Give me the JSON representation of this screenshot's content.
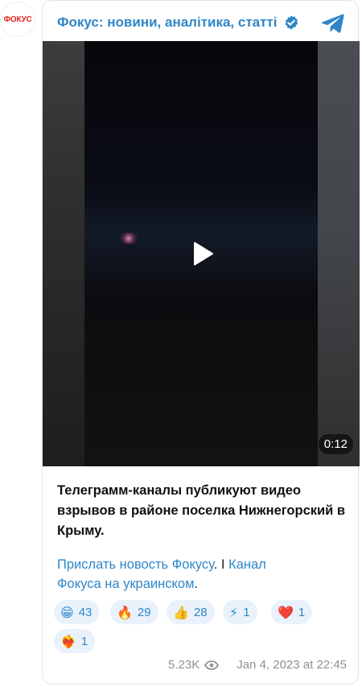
{
  "avatar": {
    "label": "ФОКУС"
  },
  "channel": {
    "title": "Фокус: новини, аналітика, статті"
  },
  "video": {
    "duration": "0:12"
  },
  "message": {
    "text": "Телеграмм-каналы публикуют видео взрывов в районе поселка Нижнегорский в Крыму.",
    "link1": "Прислать новость ",
    "link1_italic": "Фокусу",
    "sep": ". I ",
    "link2": "Канал",
    "link2_italic": "Фокуса",
    "link2_rest": " на украинском",
    "end": "."
  },
  "reactions": [
    {
      "emoji": "😁",
      "count": "43"
    },
    {
      "emoji": "🔥",
      "count": "29"
    },
    {
      "emoji": "👍",
      "count": "28"
    },
    {
      "emoji": "⚡",
      "count": "1"
    },
    {
      "emoji": "❤️",
      "count": "1"
    },
    {
      "emoji": "❤️‍🔥",
      "count": "1"
    }
  ],
  "footer": {
    "views": "5.23K",
    "date": "Jan 4, 2023 at 22:45"
  },
  "colors": {
    "accent": "#2f86c8",
    "reaction_bg": "#e9f2fb",
    "muted": "#8a9199",
    "brand_red": "#e2231a"
  }
}
